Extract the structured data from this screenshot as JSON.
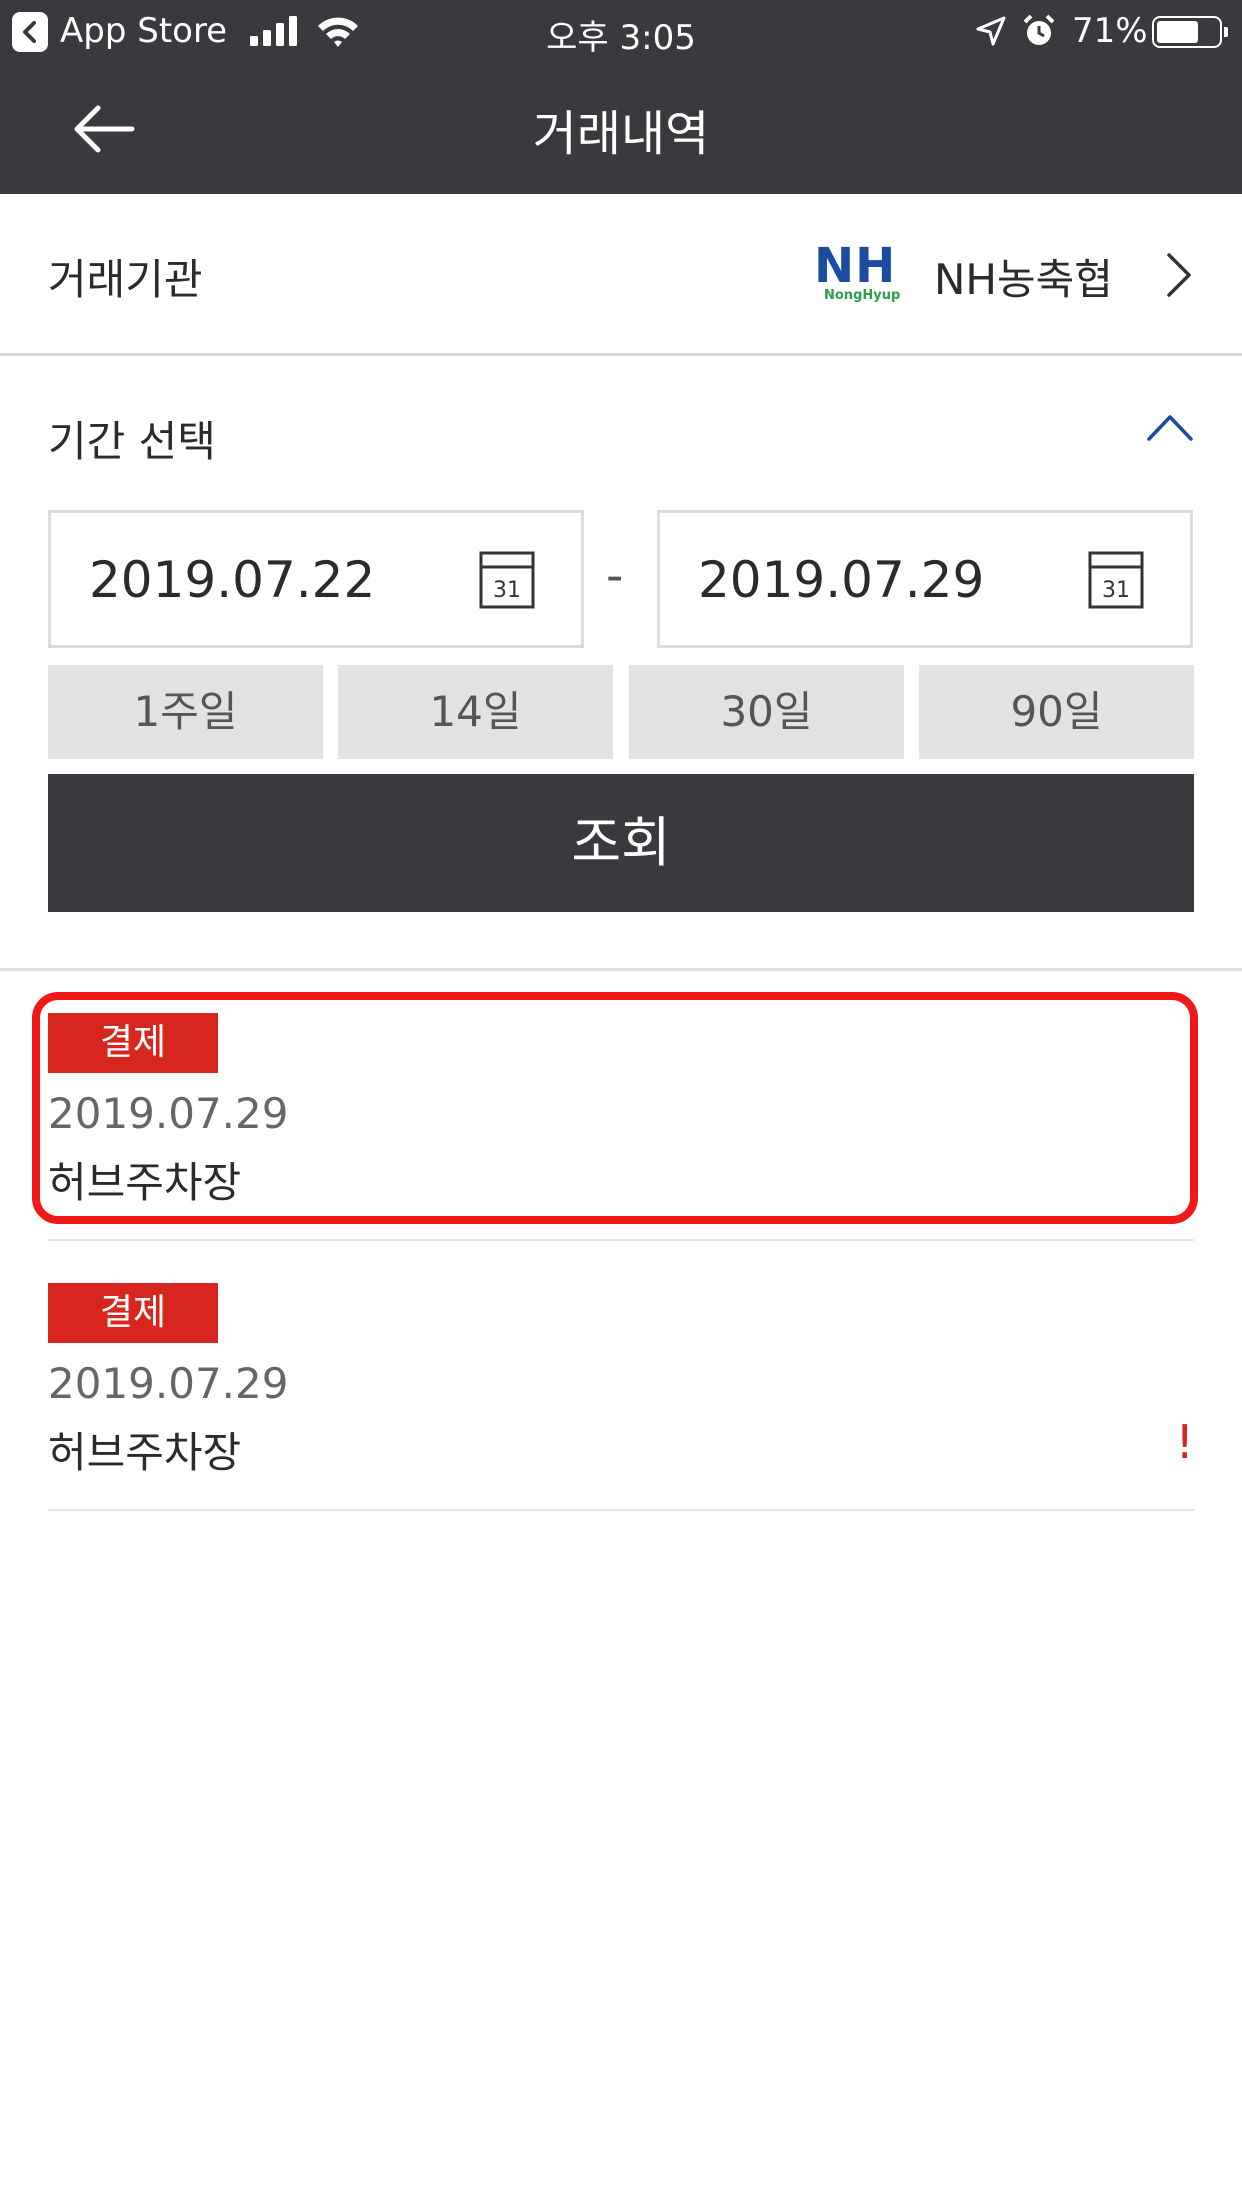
{
  "status_bar": {
    "back_app_label": "App Store",
    "time": "오후 3:05",
    "battery_percent": "71%",
    "battery_level": 0.71
  },
  "header": {
    "title": "거래내역"
  },
  "institution": {
    "label": "거래기관",
    "logo_text": "NH",
    "logo_sub": "NongHyup",
    "name": "NH농축협"
  },
  "period": {
    "label": "기간 선택",
    "date_from": "2019.07.22",
    "date_to": "2019.07.29",
    "separator": "-",
    "calendar_icon_text": "31",
    "quick_options": [
      "1주일",
      "14일",
      "30일",
      "90일"
    ],
    "search_label": "조회"
  },
  "transactions": [
    {
      "type": "결제",
      "date": "2019.07.29",
      "merchant": "허브주차장",
      "alert": ""
    },
    {
      "type": "결제",
      "date": "2019.07.29",
      "merchant": "허브주차장",
      "alert": "!"
    }
  ],
  "colors": {
    "header_bg": "#3a3a3e",
    "accent_red": "#d8261e",
    "highlight": "#f01818",
    "nh_blue": "#1c4ca0"
  }
}
